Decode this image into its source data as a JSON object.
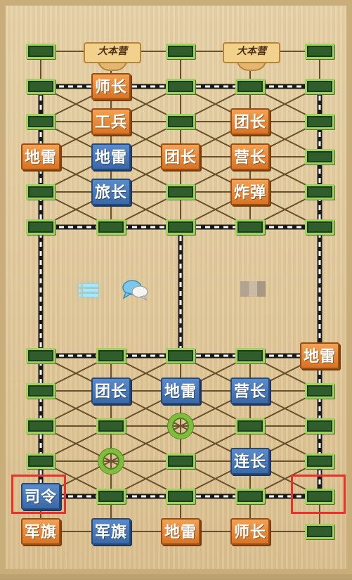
{
  "game": {
    "headquarters_label": "大本营",
    "icons": {
      "menu": "menu-icon",
      "chat": "chat-bubble-icon"
    },
    "colors": {
      "opponent_piece": "#e2852f",
      "player_piece": "#4676b6",
      "station": "#2f5d2c",
      "camp": "#7fbe3a",
      "selection": "#e8312a"
    }
  },
  "pieces": [
    {
      "id": "p1",
      "side": "opponent",
      "label": "师长"
    },
    {
      "id": "p2",
      "side": "opponent",
      "label": "工兵"
    },
    {
      "id": "p3",
      "side": "opponent",
      "label": "团长"
    },
    {
      "id": "p4",
      "side": "opponent",
      "label": "地雷"
    },
    {
      "id": "p5",
      "side": "player",
      "label": "地雷"
    },
    {
      "id": "p6",
      "side": "opponent",
      "label": "团长"
    },
    {
      "id": "p7",
      "side": "opponent",
      "label": "营长"
    },
    {
      "id": "p8",
      "side": "player",
      "label": "旅长"
    },
    {
      "id": "p9",
      "side": "opponent",
      "label": "炸弹"
    },
    {
      "id": "p10",
      "side": "opponent",
      "label": "地雷"
    },
    {
      "id": "p11",
      "side": "player",
      "label": "团长"
    },
    {
      "id": "p12",
      "side": "player",
      "label": "地雷"
    },
    {
      "id": "p13",
      "side": "player",
      "label": "营长"
    },
    {
      "id": "p14",
      "side": "player",
      "label": "连长"
    },
    {
      "id": "p15",
      "side": "player",
      "label": "司令"
    },
    {
      "id": "p16",
      "side": "opponent",
      "label": "军旗"
    },
    {
      "id": "p17",
      "side": "player",
      "label": "军旗"
    },
    {
      "id": "p18",
      "side": "opponent",
      "label": "地雷"
    },
    {
      "id": "p19",
      "side": "opponent",
      "label": "师长"
    }
  ]
}
